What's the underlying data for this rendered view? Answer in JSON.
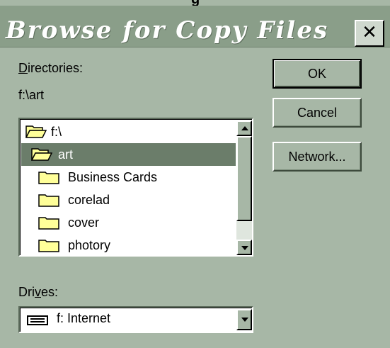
{
  "window": {
    "cutoff_text": "g",
    "title": "Browse for Copy Files",
    "close_label": "✕"
  },
  "directories": {
    "label_underlined": "D",
    "label_rest": "irectories:",
    "current_path": "f:\\art",
    "items": [
      {
        "label": "f:\\",
        "icon": "folder-open-icon"
      },
      {
        "label": "art",
        "icon": "folder-open-icon"
      },
      {
        "label": "Business Cards",
        "icon": "folder-icon"
      },
      {
        "label": "corelad",
        "icon": "folder-icon"
      },
      {
        "label": "cover",
        "icon": "folder-icon"
      },
      {
        "label": "photory",
        "icon": "folder-icon"
      }
    ],
    "selected_index": 1
  },
  "drives": {
    "label_before": "Dri",
    "label_underlined": "v",
    "label_after": "es:",
    "selected": "f: Internet",
    "icon": "network-drive-icon"
  },
  "buttons": {
    "ok": "OK",
    "cancel": "Cancel",
    "network": "Network..."
  },
  "colors": {
    "face": "#a7b7a6",
    "titlebar": "#8a9e89",
    "selection": "#6b7d6a"
  }
}
